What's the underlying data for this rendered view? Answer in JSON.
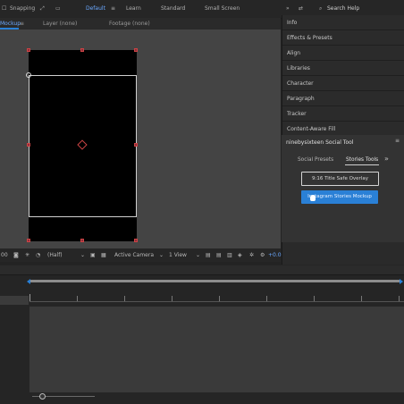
{
  "topbar": {
    "snapping": "Snapping",
    "workspaces": [
      "Default",
      "Learn",
      "Standard",
      "Small Screen"
    ],
    "search_placeholder": "Search Help"
  },
  "tabs": {
    "comp": "Mockup",
    "layer": "Layer (none)",
    "footage": "Footage (none)"
  },
  "panels": [
    "Info",
    "Effects & Presets",
    "Align",
    "Libraries",
    "Character",
    "Paragraph",
    "Tracker",
    "Content-Aware Fill"
  ],
  "plugin": {
    "title": "ninebysixteen Social Tool",
    "tabs": [
      "Social Presets",
      "Stories Tools"
    ],
    "more": "»",
    "btn_overlay": "9:16 Title Safe Overlay",
    "btn_mockup": "Instagram Stories Mockup"
  },
  "viewer_toolbar": {
    "timecode": "00",
    "resolution": "(Half)",
    "camera": "Active Camera",
    "view": "1 View",
    "exposure": "+0.0"
  },
  "colors": {
    "accent": "#2a80d6",
    "handle": "#8e2b3a"
  }
}
